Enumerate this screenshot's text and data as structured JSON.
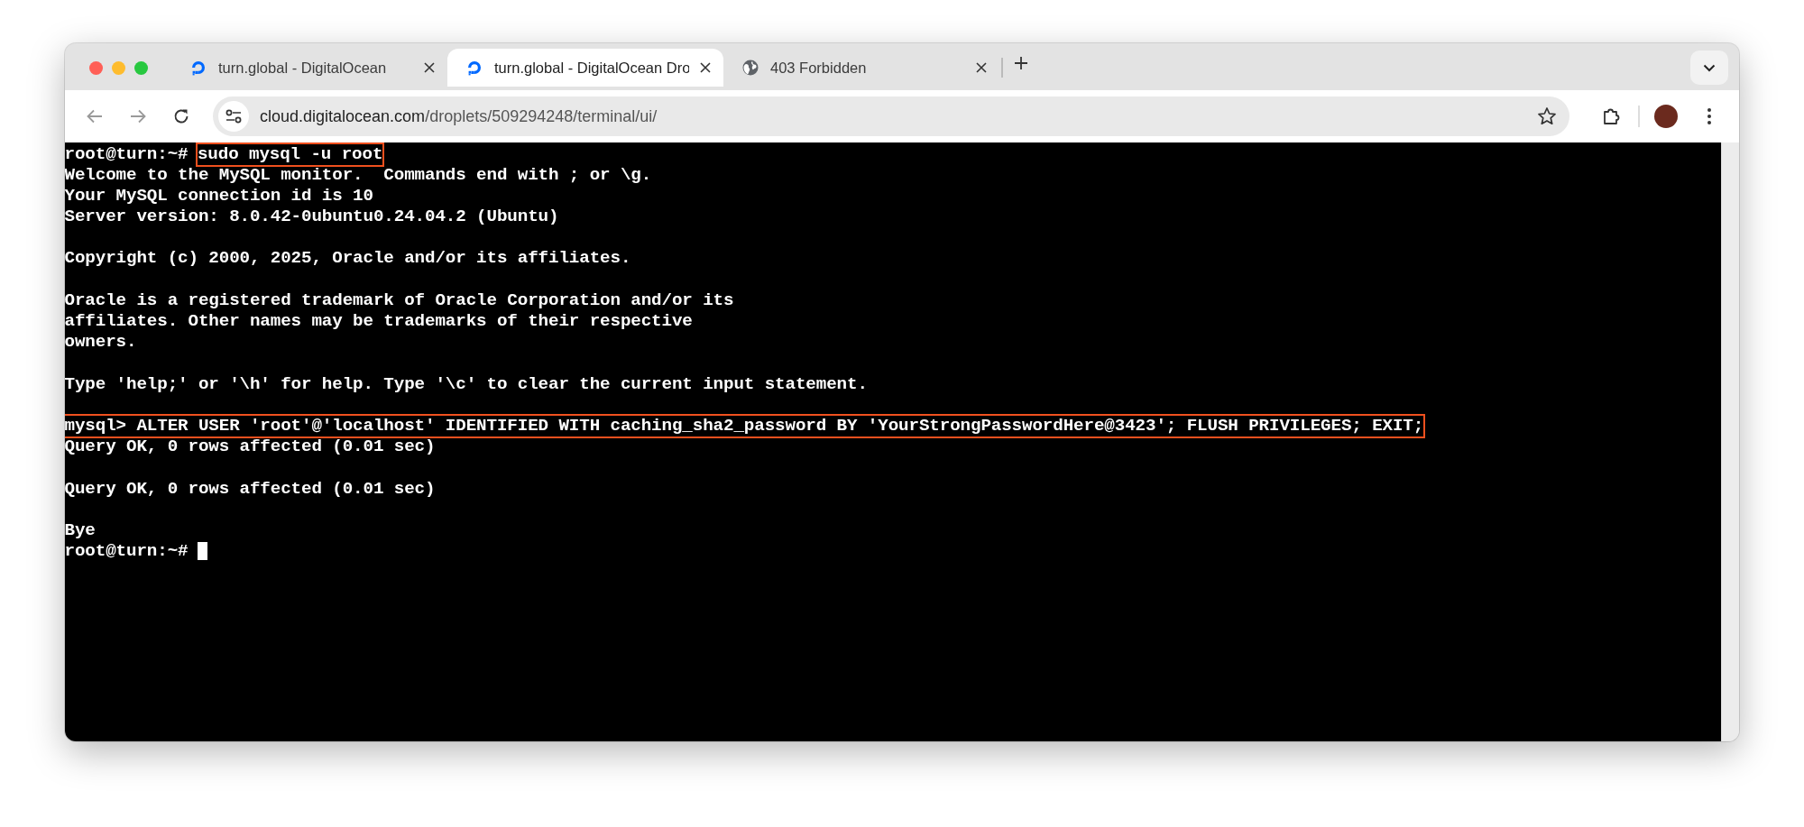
{
  "tabs": [
    {
      "title": "turn.global - DigitalOcean",
      "selected": false
    },
    {
      "title": "turn.global - DigitalOcean Dro",
      "selected": true
    },
    {
      "title": "403 Forbidden",
      "selected": false
    }
  ],
  "address_bar": {
    "url_host": "cloud.digitalocean.com",
    "url_path": "/droplets/509294248/terminal/ui/"
  },
  "terminal": {
    "lines": [
      {
        "kind": "text",
        "segments": [
          {
            "text": "root@turn:~# ",
            "highlighted": false
          },
          {
            "text": "sudo mysql -u root",
            "highlighted": true
          }
        ]
      },
      {
        "kind": "text",
        "segments": [
          {
            "text": "Welcome to the MySQL monitor.  Commands end with ; or \\g.",
            "highlighted": false
          }
        ]
      },
      {
        "kind": "text",
        "segments": [
          {
            "text": "Your MySQL connection id is 10",
            "highlighted": false
          }
        ]
      },
      {
        "kind": "text",
        "segments": [
          {
            "text": "Server version: 8.0.42-0ubuntu0.24.04.2 (Ubuntu)",
            "highlighted": false
          }
        ]
      },
      {
        "kind": "blank"
      },
      {
        "kind": "text",
        "segments": [
          {
            "text": "Copyright (c) 2000, 2025, Oracle and/or its affiliates.",
            "highlighted": false
          }
        ]
      },
      {
        "kind": "blank"
      },
      {
        "kind": "text",
        "segments": [
          {
            "text": "Oracle is a registered trademark of Oracle Corporation and/or its",
            "highlighted": false
          }
        ]
      },
      {
        "kind": "text",
        "segments": [
          {
            "text": "affiliates. Other names may be trademarks of their respective",
            "highlighted": false
          }
        ]
      },
      {
        "kind": "text",
        "segments": [
          {
            "text": "owners.",
            "highlighted": false
          }
        ]
      },
      {
        "kind": "blank"
      },
      {
        "kind": "text",
        "segments": [
          {
            "text": "Type 'help;' or '\\h' for help. Type '\\c' to clear the current input statement.",
            "highlighted": false
          }
        ]
      },
      {
        "kind": "blank"
      },
      {
        "kind": "text",
        "segments": [
          {
            "text": "mysql> ALTER USER 'root'@'localhost' IDENTIFIED WITH caching_sha2_password BY 'YourStrongPasswordHere@3423'; FLUSH PRIVILEGES; EXIT;",
            "highlighted": true
          }
        ]
      },
      {
        "kind": "text",
        "segments": [
          {
            "text": "Query OK, 0 rows affected (0.01 sec)",
            "highlighted": false
          }
        ]
      },
      {
        "kind": "blank"
      },
      {
        "kind": "text",
        "segments": [
          {
            "text": "Query OK, 0 rows affected (0.01 sec)",
            "highlighted": false
          }
        ]
      },
      {
        "kind": "blank"
      },
      {
        "kind": "text",
        "segments": [
          {
            "text": "Bye",
            "highlighted": false
          }
        ]
      },
      {
        "kind": "text",
        "segments": [
          {
            "text": "root@turn:~# ",
            "highlighted": false
          }
        ],
        "cursor": true
      }
    ]
  }
}
